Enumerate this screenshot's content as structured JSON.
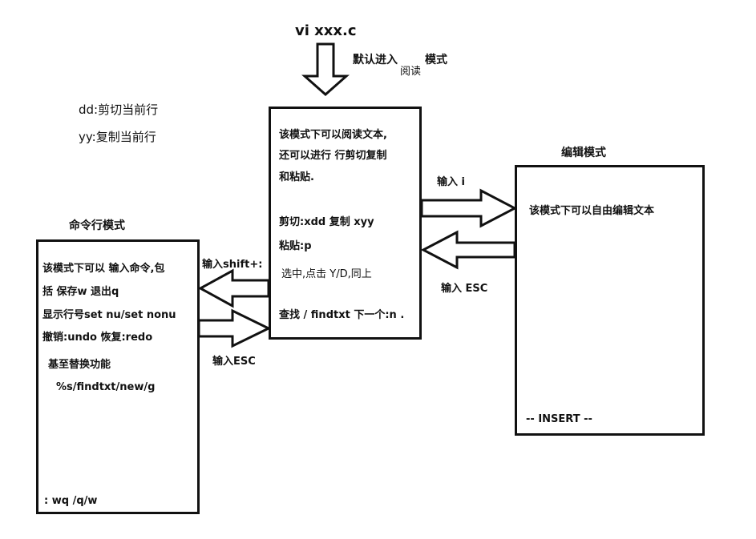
{
  "top": {
    "command": "vi xxx.c",
    "default_enter": "默认进入",
    "read_word": "阅读",
    "mode_word": "模式"
  },
  "notes": {
    "dd": "dd:剪切当前行",
    "yy": "yy:复制当前行"
  },
  "read_mode": {
    "desc1": "该模式下可以阅读文本,",
    "desc2": "还可以进行 行剪切复制",
    "desc3": "和粘贴.",
    "cut": "剪切:xdd 复制 xyy",
    "paste": "粘贴:p",
    "select": "选中,点击 Y/D,同上",
    "find": "查找 / findtxt  下一个:n ."
  },
  "edit_mode": {
    "title": "编辑模式",
    "desc": "该模式下可以自由编辑文本",
    "status": "--  INSERT  --"
  },
  "cmd_mode": {
    "title": "命令行模式",
    "desc1": "该模式下可以 输入命令,包",
    "desc2": "括  保存w  退出q",
    "line_num": "显示行号set nu/set nonu",
    "undo": "撤销:undo 恢复:redo",
    "replace": "基至替换功能",
    "replace_cmd": "%s/findtxt/new/g",
    "save_quit": ": wq  /q/w"
  },
  "arrows": {
    "enter_i": "输入 i",
    "enter_esc_right": "输入 ESC",
    "enter_shift": "输入shift+:",
    "enter_esc_left": "输入ESC"
  }
}
